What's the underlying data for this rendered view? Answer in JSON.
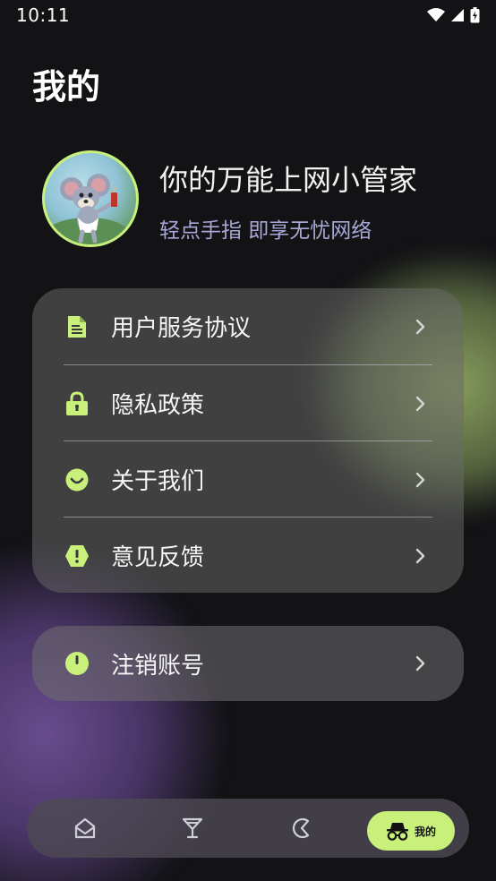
{
  "status_bar": {
    "time": "10:11"
  },
  "page": {
    "title": "我的"
  },
  "profile": {
    "name": "你的万能上网小管家",
    "subtitle": "轻点手指 即享无忧网络"
  },
  "menu": {
    "items": [
      {
        "label": "用户服务协议",
        "icon": "document-icon"
      },
      {
        "label": "隐私政策",
        "icon": "lock-icon"
      },
      {
        "label": "关于我们",
        "icon": "smile-icon"
      },
      {
        "label": "意见反馈",
        "icon": "alert-icon"
      }
    ]
  },
  "logout": {
    "label": "注销账号",
    "icon": "power-icon"
  },
  "tabbar": {
    "tabs": [
      {
        "icon": "home-icon"
      },
      {
        "icon": "cocktail-icon"
      },
      {
        "icon": "moon-icon"
      },
      {
        "icon": "incognito-icon",
        "label": "我的",
        "active": true
      }
    ]
  },
  "colors": {
    "accent": "#c9f07a",
    "subtitle": "#a9a7d6",
    "background": "#131316"
  }
}
